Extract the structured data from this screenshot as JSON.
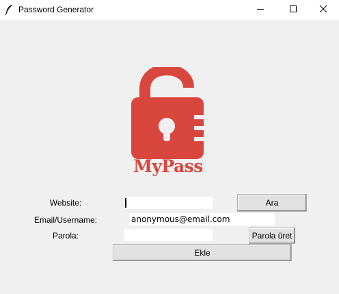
{
  "window": {
    "title": "Password Generator",
    "app_icon": "feather-icon",
    "controls": [
      "minimize-icon",
      "maximize-icon",
      "close-icon"
    ]
  },
  "logo": {
    "text": "MyPass",
    "icon": "padlock-icon",
    "color": "#d9463d"
  },
  "form": {
    "website_label": "Website:",
    "website_value": "",
    "email_label": "Email/Username:",
    "email_value": "anonymous@email.com",
    "password_label": "Parola:",
    "password_value": ""
  },
  "buttons": {
    "search": "Ara",
    "generate": "Parola üret",
    "add": "Ekle"
  }
}
